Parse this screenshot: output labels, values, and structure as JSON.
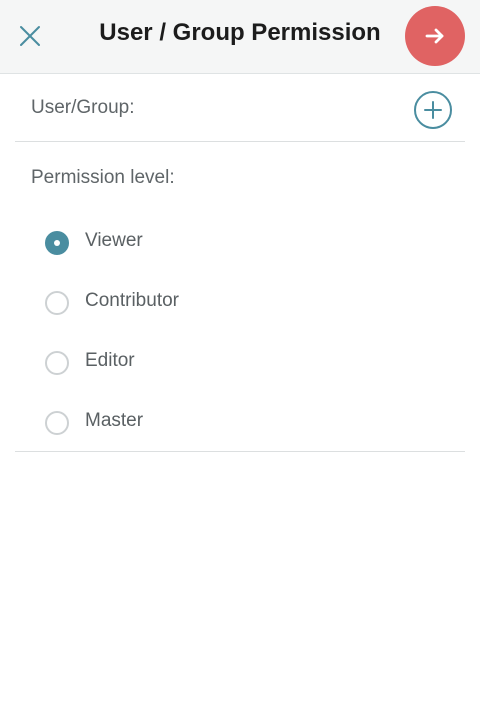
{
  "header": {
    "title": "User / Group Permission",
    "close_icon": "close-icon",
    "next_icon": "arrow-right-icon"
  },
  "user_group": {
    "label": "User/Group:",
    "add_icon": "plus-circle-icon"
  },
  "permission": {
    "label": "Permission level:",
    "options": [
      {
        "label": "Viewer",
        "checked": true
      },
      {
        "label": "Contributor",
        "checked": false
      },
      {
        "label": "Editor",
        "checked": false
      },
      {
        "label": "Master",
        "checked": false
      }
    ],
    "selected": "Viewer"
  },
  "colors": {
    "accent": "#4a8da0",
    "next_button": "#e06363",
    "header_bg": "#f5f6f6",
    "text": "#5f6568"
  }
}
